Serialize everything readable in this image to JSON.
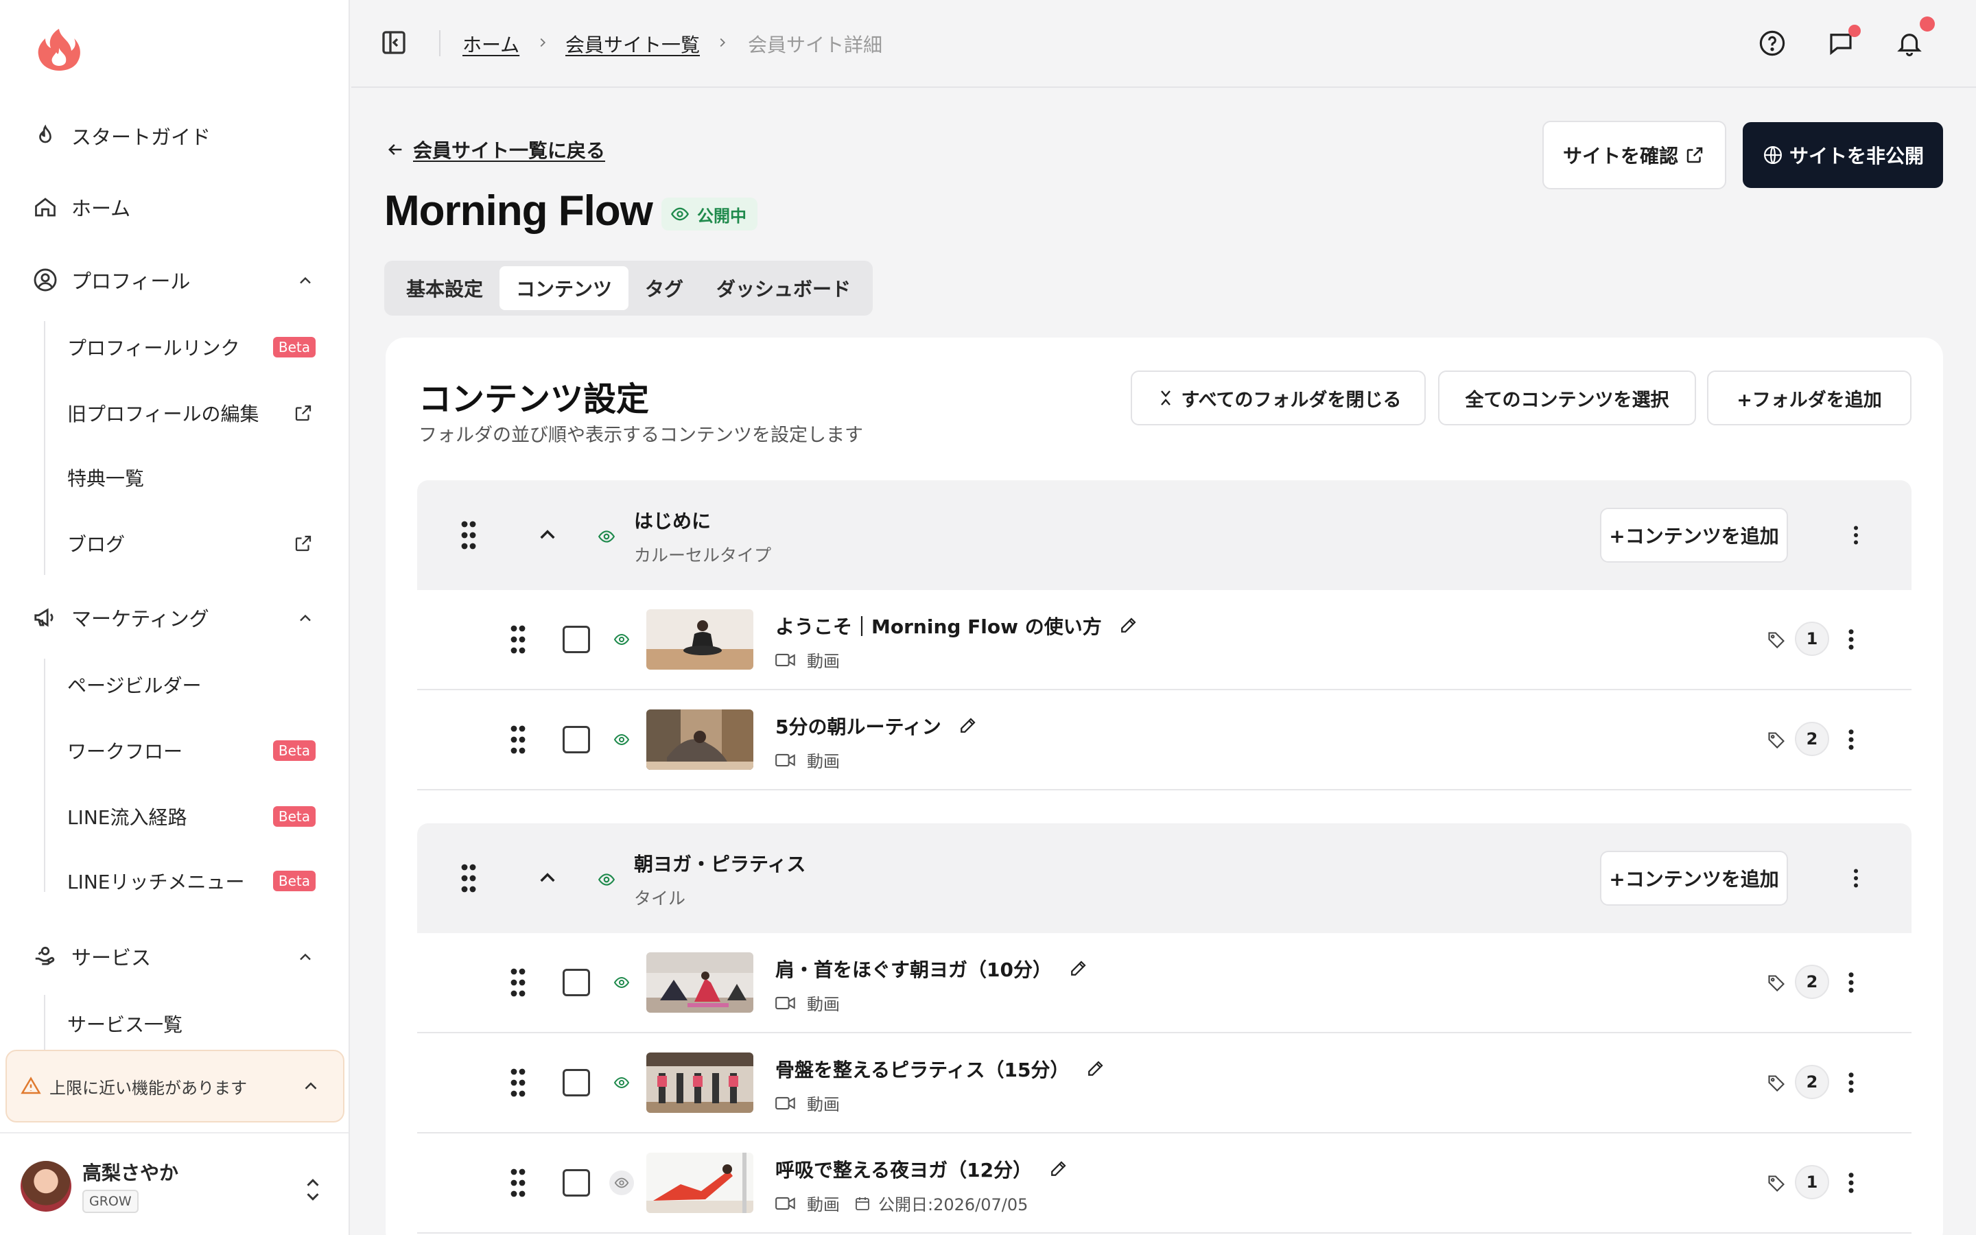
{
  "sidebar": {
    "start_guide": "スタートガイド",
    "home": "ホーム",
    "profile": "プロフィール",
    "profile_link": "プロフィールリンク",
    "old_profile_edit": "旧プロフィールの編集",
    "benefits": "特典一覧",
    "blog": "ブログ",
    "marketing": "マーケティング",
    "page_builder": "ページビルダー",
    "workflow": "ワークフロー",
    "line_inflow": "LINE流入経路",
    "line_rich_menu": "LINEリッチメニュー",
    "services": "サービス",
    "service_list": "サービス一覧",
    "beta": "Beta",
    "warning": "上限に近い機能があります",
    "user_name": "高梨さやか",
    "user_plan": "GROW"
  },
  "header": {
    "breadcrumb_home": "ホーム",
    "breadcrumb_sites": "会員サイト一覧",
    "breadcrumb_current": "会員サイト詳細"
  },
  "page": {
    "back_label": "会員サイト一覧に戻る",
    "view_site_label": "サイトを確認",
    "unpublish_label": "サイトを非公開",
    "title": "Morning Flow",
    "status": "公開中",
    "tabs": [
      "基本設定",
      "コンテンツ",
      "タグ",
      "ダッシュボード"
    ],
    "active_tab": "コンテンツ"
  },
  "content": {
    "title": "コンテンツ設定",
    "description": "フォルダの並び順や表示するコンテンツを設定します",
    "close_all": "すべてのフォルダを閉じる",
    "select_all": "全てのコンテンツを選択",
    "add_folder": "+フォルダを追加",
    "add_content": "+コンテンツを追加",
    "folders": [
      {
        "name": "はじめに",
        "type": "カルーセルタイプ",
        "items": [
          {
            "title": "ようこそ｜Morning Flow の使い方",
            "kind": "動画",
            "tags": "1"
          },
          {
            "title": "5分の朝ルーティン",
            "kind": "動画",
            "tags": "2"
          }
        ]
      },
      {
        "name": "朝ヨガ・ピラティス",
        "type": "タイル",
        "items": [
          {
            "title": "肩・首をほぐす朝ヨガ（10分）",
            "kind": "動画",
            "tags": "2"
          },
          {
            "title": "骨盤を整えるピラティス（15分）",
            "kind": "動画",
            "tags": "2"
          },
          {
            "title": "呼吸で整える夜ヨガ（12分）",
            "kind": "動画",
            "tags": "1",
            "publish_date": "公開日:2026/07/05"
          }
        ]
      }
    ]
  },
  "colors": {
    "accent_dark": "#101828",
    "status_green": "#1f8a4c",
    "beta_red": "#f06070",
    "notification_dot": "#f05c64"
  },
  "icons": [
    "flame-logo",
    "flame-icon",
    "home-icon",
    "user-circle-icon",
    "megaphone-icon",
    "hand-service-icon",
    "external-link-icon",
    "warning-icon",
    "help-icon",
    "chat-icon",
    "bell-icon",
    "sidebar-toggle-icon",
    "arrow-left-icon",
    "globe-icon",
    "eye-icon",
    "drag-handle-icon",
    "chevron-up-icon",
    "pencil-icon",
    "video-icon",
    "tag-icon",
    "more-vertical-icon",
    "calendar-icon"
  ]
}
